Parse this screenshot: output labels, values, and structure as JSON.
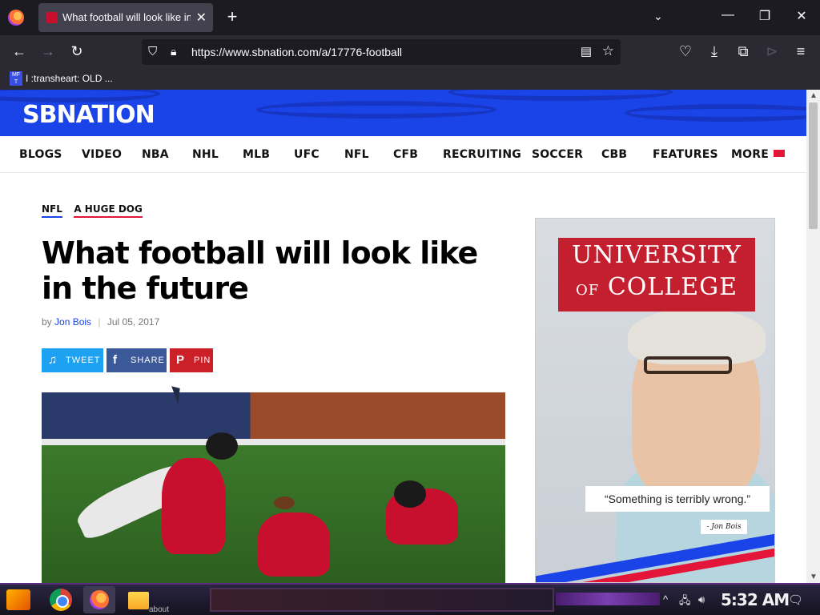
{
  "browser": {
    "tab": {
      "title": "What football will look like in"
    },
    "url": "https://www.sbnation.com/a/17776-football",
    "bookmarks": [
      {
        "label": "I :transheart: OLD ..."
      }
    ],
    "bookmark_icon_text": "MF T"
  },
  "site": {
    "logo": "SBNATION",
    "nav": [
      {
        "label": "BLOGS"
      },
      {
        "label": "VIDEO"
      },
      {
        "label": "NBA"
      },
      {
        "label": "NHL"
      },
      {
        "label": "MLB"
      },
      {
        "label": "UFC"
      },
      {
        "label": "NFL"
      },
      {
        "label": "CFB"
      },
      {
        "label": "RECRUITING"
      },
      {
        "label": "SOCCER"
      },
      {
        "label": "CBB"
      },
      {
        "label": "FEATURES"
      },
      {
        "label": "MORE"
      }
    ],
    "brand_blue": "#1a43e8",
    "brand_red": "#e3163a"
  },
  "article": {
    "categories": [
      "NFL",
      "A HUGE DOG"
    ],
    "title": "What football will look like in the future",
    "byline_prefix": "by",
    "author": "Jon Bois",
    "date": "Jul 05, 2017",
    "share": {
      "tweet": "TWEET",
      "share": "SHARE",
      "pin": "PIN"
    }
  },
  "ad": {
    "line1": "UNIVERSITY",
    "line2_small": "OF",
    "line2": "COLLEGE",
    "quote": "“Something is terribly wrong.”",
    "attribution": "- Jon Bois"
  },
  "taskbar": {
    "about_label": "about",
    "clock": "5:32 AM"
  }
}
